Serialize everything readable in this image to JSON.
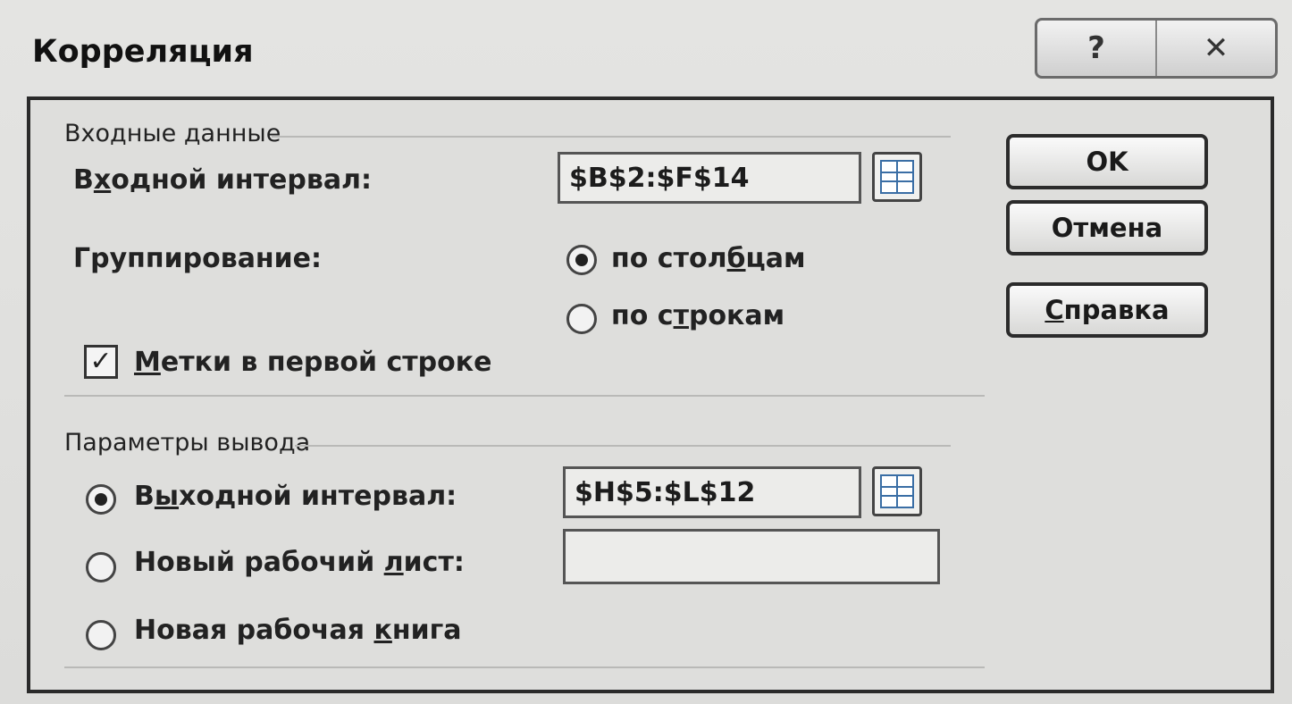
{
  "dialog": {
    "title": "Корреляция",
    "help_glyph": "?",
    "close_glyph": "✕"
  },
  "input": {
    "section_title": "Входные данные",
    "range_label_pre": "В",
    "range_label_u": "х",
    "range_label_post": "одной интервал:",
    "range_value": "$B$2:$F$14",
    "grouping_label": "Группирование:",
    "by_columns_pre": "по стол",
    "by_columns_u": "б",
    "by_columns_post": "цам",
    "by_rows_pre": "по с",
    "by_rows_u": "т",
    "by_rows_post": "рокам",
    "labels_pre": "",
    "labels_u": "М",
    "labels_post": "етки в первой строке",
    "labels_checked": true,
    "check_glyph": "✓",
    "grouping_selected": "by_columns"
  },
  "output": {
    "section_title": "Параметры вывода",
    "out_range_pre": "В",
    "out_range_u": "ы",
    "out_range_post": "ходной интервал:",
    "out_range_value": "$H$5:$L$12",
    "new_sheet_pre": "Новый рабочий ",
    "new_sheet_u": "л",
    "new_sheet_post": "ист:",
    "new_sheet_value": "",
    "new_book_pre": "Новая рабочая ",
    "new_book_u": "к",
    "new_book_post": "нига",
    "selected": "output_range"
  },
  "buttons": {
    "ok": "OK",
    "cancel": "Отмена",
    "help_u": "С",
    "help_post": "правка"
  }
}
